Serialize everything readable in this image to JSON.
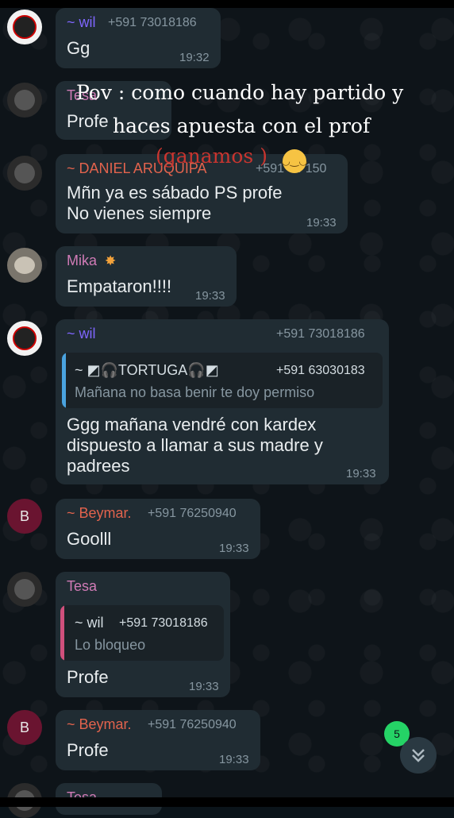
{
  "overlay": {
    "line1": "Pov : como cuando hay partido y",
    "line2": "haces apuesta con el prof",
    "line3": "(ganamos )",
    "emoji": "relieved-face-emoji"
  },
  "messages": [
    {
      "sender": "~ wil",
      "phone": "+591 73018186",
      "text": "Gg",
      "time": "19:32",
      "sender_color": "#7f66ff"
    },
    {
      "sender": "Tesa",
      "text": "Profe",
      "sender_color": "#d07bb6"
    },
    {
      "sender": "~ DANIEL ARUQUIPA",
      "phone": "+591 64 150",
      "text": "Mñn ya es sábado PS profe\nNo vienes siempre",
      "time": "19:33",
      "sender_color": "#e2634d"
    },
    {
      "sender": "Mika",
      "sender_icon": "sparkle-icon",
      "text": "Empataron!!!!",
      "time": "19:33",
      "sender_color": "#d07bb6"
    },
    {
      "sender": "~ wil",
      "phone": "+591 73018186",
      "quote": {
        "sender": "~ ◩🎧TORTUGA🎧◩",
        "phone": "+591 63030183",
        "text": "Mañana no basa benir te doy permiso",
        "bar_color": "#4aa3df"
      },
      "text": "Ggg mañana vendré con kardex\ndispuesto a llamar a sus madre y\npadrees",
      "time": "19:33",
      "sender_color": "#7f66ff"
    },
    {
      "sender": "~ Beymar.",
      "phone": "+591 76250940",
      "avatar_letter": "B",
      "text": "Goolll",
      "time": "19:33",
      "sender_color": "#e2634d"
    },
    {
      "sender": "Tesa",
      "quote": {
        "sender": "~ wil",
        "phone": "+591 73018186",
        "text": "Lo bloqueo",
        "bar_color": "#d0507c"
      },
      "text": "Profe",
      "time": "19:33",
      "sender_color": "#d07bb6"
    },
    {
      "sender": "~ Beymar.",
      "phone": "+591 76250940",
      "avatar_letter": "B",
      "text": "Profe",
      "time": "19:33",
      "sender_color": "#e2634d"
    },
    {
      "sender": "Tesa",
      "sender_color": "#d07bb6"
    }
  ],
  "unread_badge": "5",
  "scroll_icon": "double-chevron-down-icon"
}
